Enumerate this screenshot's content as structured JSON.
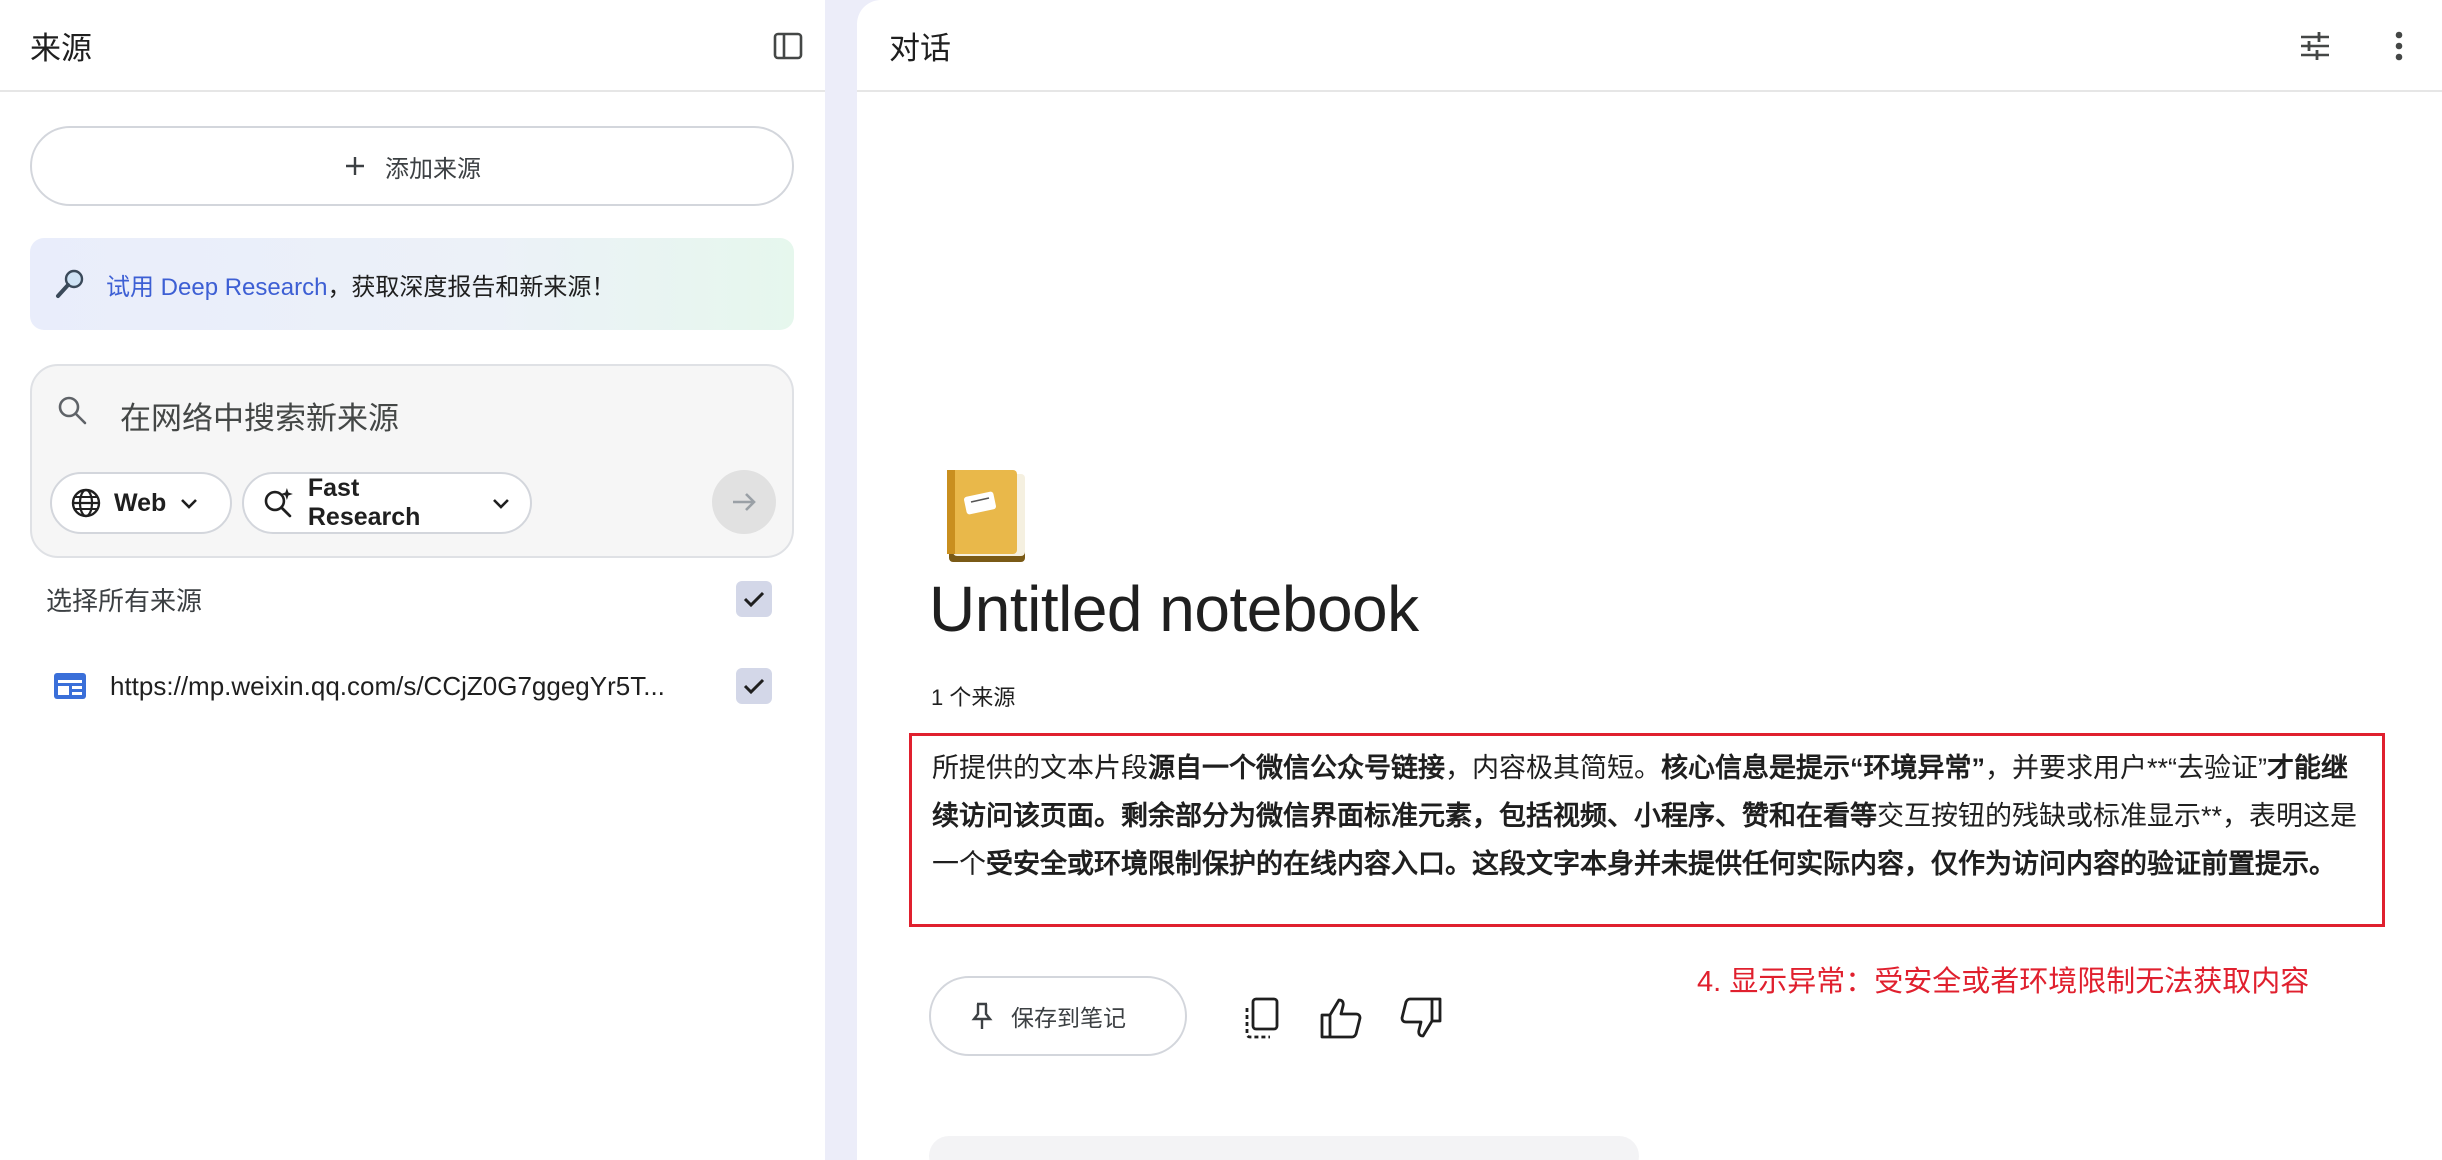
{
  "sources_panel": {
    "title": "来源",
    "add_source_label": "添加来源",
    "deep_research": {
      "link_text": "试用 Deep Research",
      "rest_text": "，获取深度报告和新来源！"
    },
    "search": {
      "placeholder": "在网络中搜索新来源",
      "web_chip": "Web",
      "research_chip": "Fast Research"
    },
    "select_all_label": "选择所有来源",
    "sources": [
      {
        "title": "https://mp.weixin.qq.com/s/CCjZ0G7ggegYr5T...",
        "checked": true
      }
    ]
  },
  "chat_panel": {
    "title": "对话",
    "notebook_title": "Untitled notebook",
    "source_count": "1 个来源",
    "summary": {
      "p1": "所提供的文本片段",
      "b1": "源自一个微信公众号链接",
      "p2": "，内容极其简短。",
      "b2": "核心信息是提示“环境异常”",
      "p3": "，并要求用户**“去验证”",
      "b3": "才能继续访问该页面。剩余部分为微信界面标准元素，包括视频、小程序、赞和在看等",
      "p4": "交互按钮的残缺或标准显示**，表明这是一个",
      "b4": "受安全或环境限制保护的在线内容入口。这段文字本身并未提供任何实际内容，仅作为访问内容的验证前置提示。"
    },
    "annotation": "4. 显示异常：受安全或者环境限制无法获取内容",
    "save_note_label": "保存到笔记"
  },
  "colors": {
    "accent_blue": "#3d5fd4",
    "annotation_red": "#e0202e",
    "background_lavender": "#ecedf9"
  }
}
